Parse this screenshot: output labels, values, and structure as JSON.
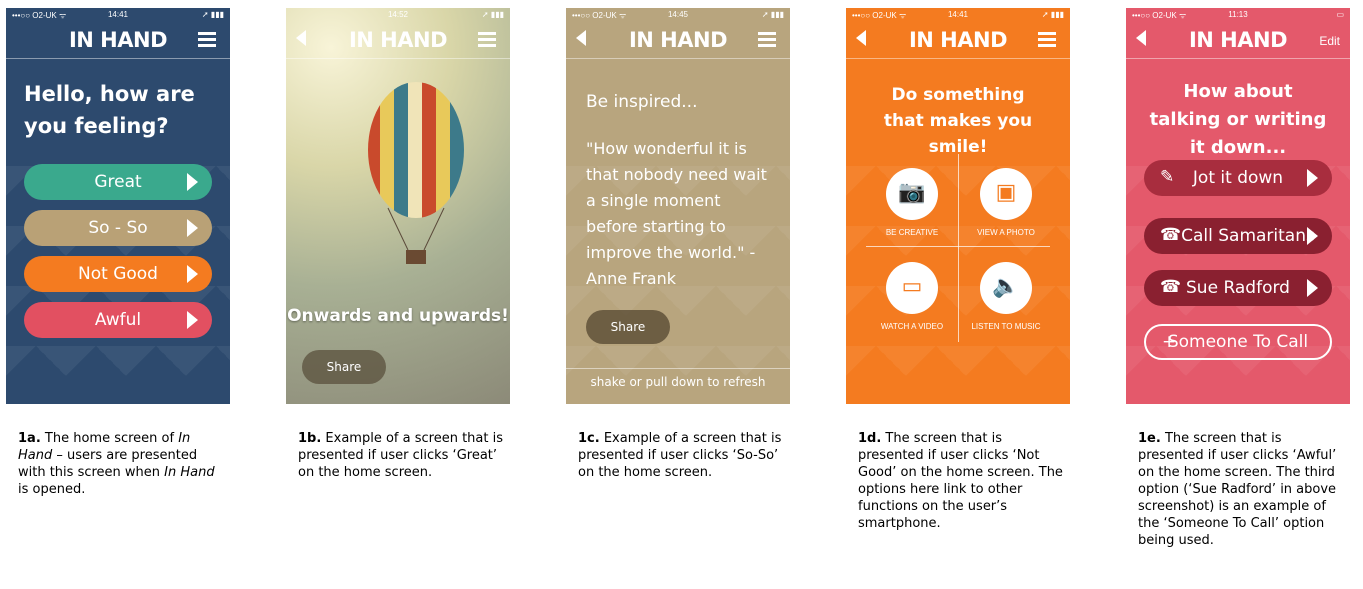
{
  "screens": {
    "a": {
      "status": {
        "carrier": "•••○○ O2-UK ᯤ",
        "time": "14:41",
        "right": "➚ ▮▮▮"
      },
      "title": "IN HAND",
      "heading": "Hello, how are you feeling?",
      "buttons": [
        {
          "label": "Great",
          "color": "#3aa98d"
        },
        {
          "label": "So - So",
          "color": "#b9a176"
        },
        {
          "label": "Not Good",
          "color": "#f47b20"
        },
        {
          "label": "Awful",
          "color": "#e25061"
        }
      ],
      "bg": "#2d4a6e"
    },
    "b": {
      "status": {
        "carrier": "",
        "time": "14:52",
        "right": "➚ ▮▮▮"
      },
      "title": "IN HAND",
      "heading": "Onwards and upwards!",
      "share": "Share"
    },
    "c": {
      "status": {
        "carrier": "•••○○ O2-UK ᯤ",
        "time": "14:45",
        "right": "➚ ▮▮▮"
      },
      "title": "IN HAND",
      "intro": "Be inspired...",
      "quote": "\"How wonderful it is that nobody need wait a single moment before starting to improve the world.\" - Anne Frank",
      "share": "Share",
      "refresh": "shake or pull down to refresh",
      "bg": "#b8a57e"
    },
    "d": {
      "status": {
        "carrier": "•••○○ O2-UK ᯤ",
        "time": "14:41",
        "right": "➚ ▮▮▮"
      },
      "title": "IN HAND",
      "heading": "Do something that makes you smile!",
      "options": [
        {
          "label": "BE CREATIVE",
          "icon": "camera-icon"
        },
        {
          "label": "VIEW A PHOTO",
          "icon": "photo-icon"
        },
        {
          "label": "WATCH A VIDEO",
          "icon": "tv-icon"
        },
        {
          "label": "LISTEN TO MUSIC",
          "icon": "speaker-icon"
        }
      ],
      "bg": "#f47b20"
    },
    "e": {
      "status": {
        "carrier": "•••○○ O2-UK ᯤ",
        "time": "11:13",
        "right": "▭"
      },
      "title": "IN HAND",
      "edit": "Edit",
      "heading": "How about talking or writing it down...",
      "buttons": [
        {
          "label": "Jot it down",
          "icon": "pencil-icon"
        },
        {
          "label": "Call Samaritans",
          "icon": "phone-icon"
        },
        {
          "label": "Sue Radford",
          "icon": "phone-icon"
        },
        {
          "label": "Someone To Call",
          "icon": "plus-icon"
        }
      ],
      "bg": "#e4596b"
    }
  },
  "captions": {
    "a": {
      "num": "1a.",
      "p1": " The home screen of ",
      "app1": "In Hand",
      "p2": " – users are presented with this screen when ",
      "app2": "In Hand",
      "p3": " is opened."
    },
    "b": {
      "num": "1b.",
      "text": " Example of a screen that is presented if user clicks ‘Great’ on the home screen."
    },
    "c": {
      "num": "1c.",
      "text": " Example of a screen that is presented if user clicks ‘So-So’ on the home screen."
    },
    "d": {
      "num": "1d.",
      "text": " The screen that is presented if user clicks ‘Not Good’ on the home screen. The options here link to other functions on the user’s smartphone."
    },
    "e": {
      "num": "1e.",
      "text": " The screen that is presented if user clicks ‘Awful’ on the home screen. The third option (‘Sue Radford’ in above screenshot) is an example of the ‘Someone To Call’ option being used."
    }
  }
}
